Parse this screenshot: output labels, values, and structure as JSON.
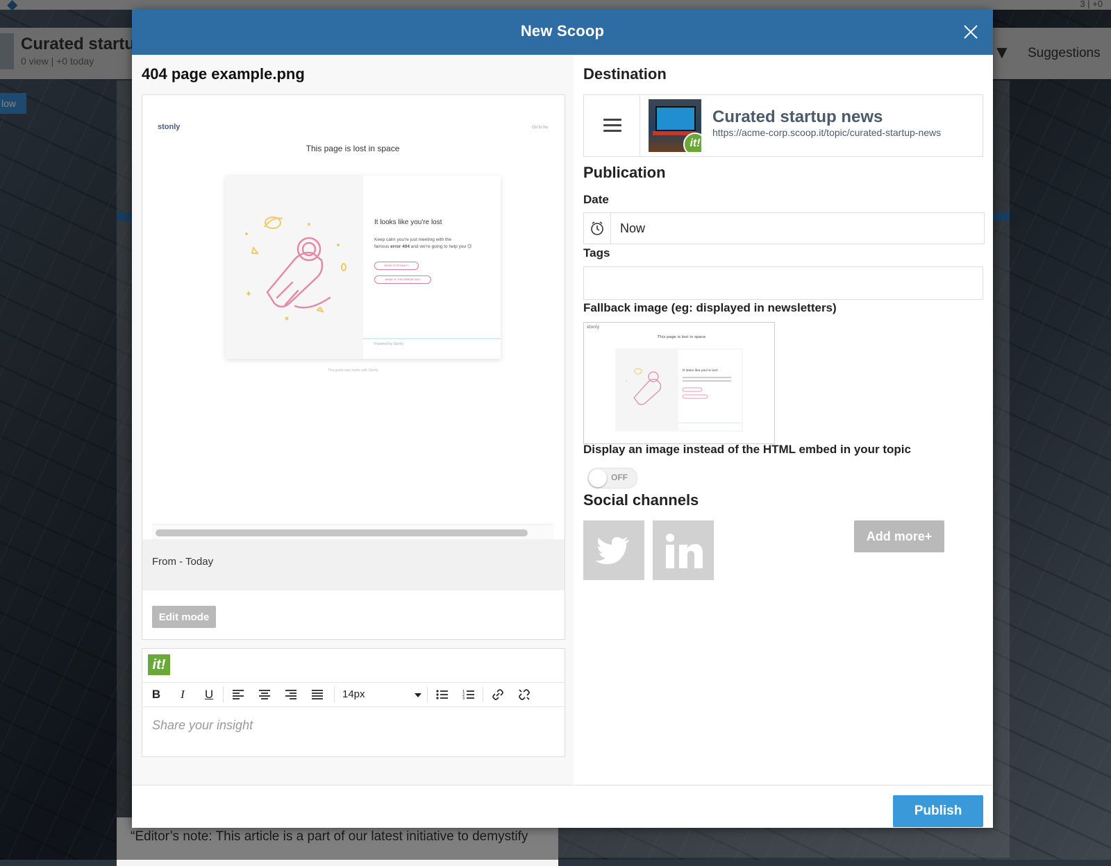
{
  "background": {
    "counter": "3 | +0",
    "topic_title": "Curated startup",
    "topic_stats": "0 view | +0 today",
    "suggestions_label": "Suggestions",
    "follow_label": "low",
    "article_text": "“Editor’s note: This article is a part of our latest initiative to demystify"
  },
  "modal": {
    "title": "New Scoop",
    "close_icon": "close-icon",
    "accent_color": "#2e6da4",
    "publish_label": "Publish",
    "publish_color": "#3a9ad9"
  },
  "left": {
    "file_name": "404 page example.png",
    "from_text": "From - Today",
    "edit_mode_label": "Edit mode",
    "preview": {
      "logo": "stonly",
      "goto": "Go to hu",
      "heading": "This page is lost in space",
      "lost_title": "It looks like you're lost",
      "desc_1": "Keep calm you're just meeting with the",
      "desc_2a": "famous ",
      "desc_2b": "error 404",
      "desc_2c": " and we're going to help you 😉",
      "pill_1": "WHAT IS STONLY?",
      "pill_2": "WHAT IS THE ERROR 404?",
      "footer": "Powered by Stonly",
      "bottom": "This guide was made with Stonly"
    },
    "editor": {
      "logo_text": "it!",
      "font_size": "14px",
      "placeholder": "Share your insight",
      "tools": [
        "bold-icon",
        "italic-icon",
        "underline-icon",
        "align-left-icon",
        "align-center-icon",
        "align-right-icon",
        "align-justify-icon",
        "bullet-list-icon",
        "numbered-list-icon",
        "link-icon",
        "unlink-icon"
      ]
    }
  },
  "right": {
    "destination_title": "Destination",
    "topic_name": "Curated startup news",
    "topic_url": "https://acme-corp.scoop.it/topic/curated-startup-news",
    "thumb_badge": "it!",
    "publication_title": "Publication",
    "date_label": "Date",
    "date_value": "Now",
    "tags_label": "Tags",
    "fallback_label": "Fallback image (eg: displayed in newsletters)",
    "display_image_label": "Display an image instead of the HTML embed in your topic",
    "toggle_state": "OFF",
    "social_title": "Social channels",
    "add_more_label": "Add more+",
    "social_icons": [
      "twitter-icon",
      "linkedin-icon"
    ]
  }
}
